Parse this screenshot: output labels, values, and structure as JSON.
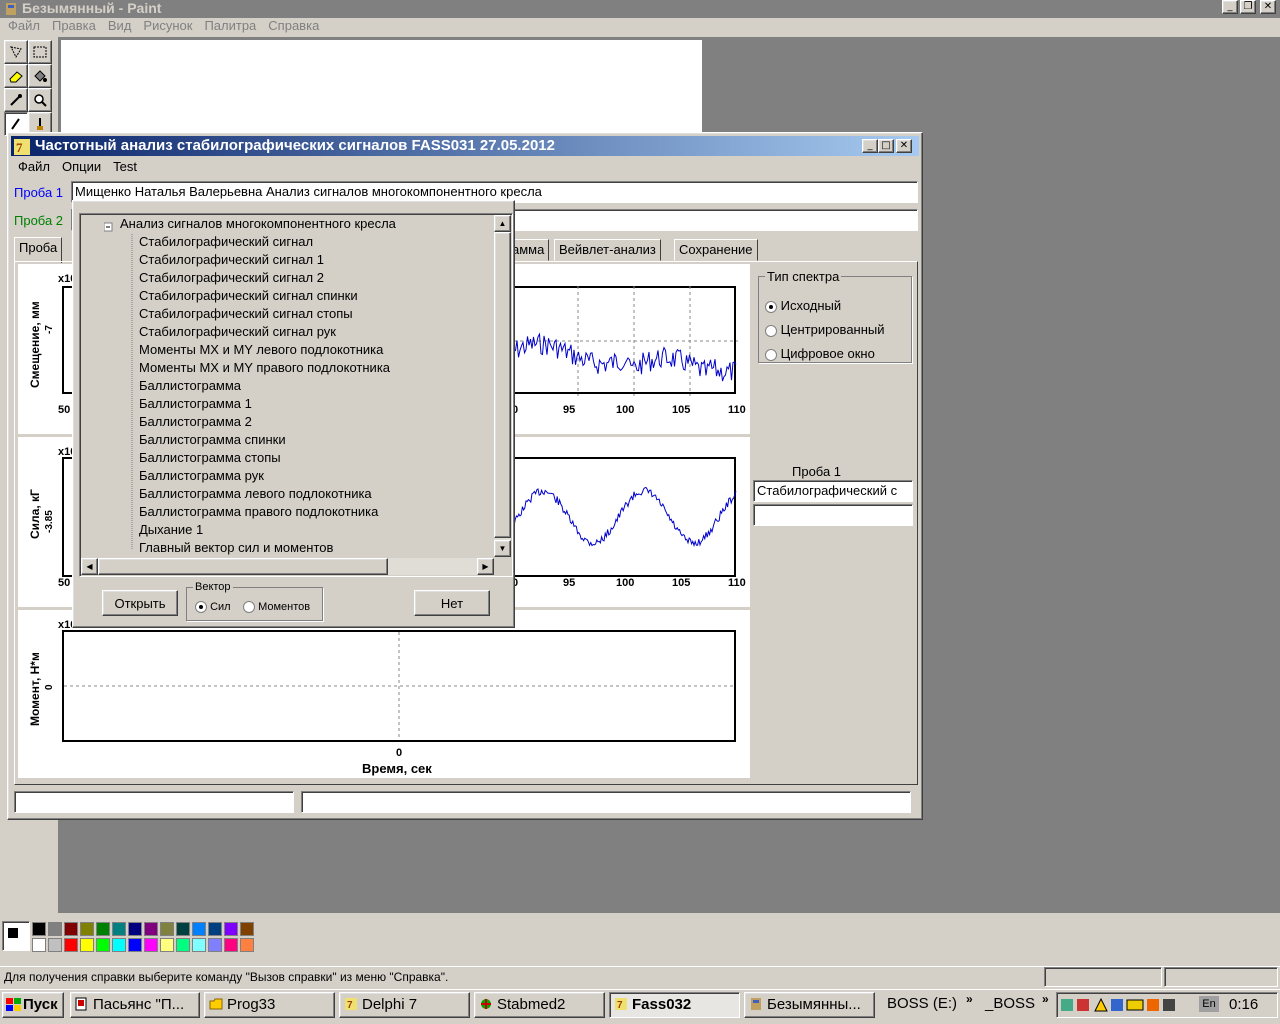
{
  "paint": {
    "title": "Безымянный - Paint",
    "menu": [
      "Файл",
      "Правка",
      "Вид",
      "Рисунок",
      "Палитра",
      "Справка"
    ],
    "status": "Для получения справки выберите команду \"Вызов справки\" из меню \"Справка\".",
    "palette": [
      "#000000",
      "#808080",
      "#800000",
      "#808000",
      "#008000",
      "#008080",
      "#000080",
      "#800080",
      "#808040",
      "#004040",
      "#0080ff",
      "#004080",
      "#8000ff",
      "#804000",
      "#ffffff",
      "#c0c0c0",
      "#ff0000",
      "#ffff00",
      "#00ff00",
      "#00ffff",
      "#0000ff",
      "#ff00ff",
      "#ffff80",
      "#00ff80",
      "#80ffff",
      "#8080ff",
      "#ff0080",
      "#ff8040"
    ]
  },
  "fass": {
    "title": "Частотный анализ стабилографических сигналов  FASS031  27.05.2012",
    "menu": [
      "Файл",
      "Опции",
      "Test"
    ],
    "probe1_label": "Проба 1",
    "probe1_value": "Мищенко Наталья Валерьевна Анализ сигналов многокомпонентного кресла",
    "probe2_label": "Проба 2",
    "tabs": [
      "Проба",
      "амма",
      "Вейвлет-анализ",
      "Сохранение"
    ],
    "spectrum": {
      "legend": "Тип спектра",
      "options": [
        "Исходный",
        "Центрированный",
        "Цифровое окно"
      ],
      "selected": 0
    },
    "probe_side_label": "Проба 1",
    "probe_side_value": "Стабилографический с",
    "charts": {
      "top": {
        "ylabel": "Смещение, мм",
        "ytick": "-7",
        "exp": "x10",
        "xticks_left": "50",
        "xticks_right": [
          "0",
          "95",
          "100",
          "105",
          "110"
        ]
      },
      "mid": {
        "ylabel": "Сила, кГ",
        "ytick": "-3.85",
        "exp": "x10",
        "xticks_left": "50",
        "xticks_right": [
          "0",
          "95",
          "100",
          "105",
          "110"
        ]
      },
      "bottom": {
        "ylabel": "Момент, Н*м",
        "ytick": "0",
        "exp": "x10",
        "xtick": "0",
        "xlabel": "Время, сек"
      }
    }
  },
  "dialog": {
    "root": "Анализ сигналов многокомпонентного кресла",
    "items": [
      "Стабилографический сигнал",
      "Стабилографический сигнал 1",
      "Стабилографический сигнал 2",
      "Стабилографический сигнал спинки",
      "Стабилографический сигнал стопы",
      "Стабилографический сигнал рук",
      "Моменты MX и MY левого подлокотника",
      "Моменты MX и MY правого подлокотника",
      "Баллистограмма",
      "Баллистограмма 1",
      "Баллистограмма 2",
      "Баллистограмма спинки",
      "Баллистограмма стопы",
      "Баллистограмма рук",
      "Баллистограмма левого подлокотника",
      "Баллистограмма правого подлокотника",
      "Дыхание 1",
      "Главный вектор сил и моментов"
    ],
    "open": "Открыть",
    "vector_legend": "Вектор",
    "vector_options": [
      "Сил",
      "Моментов"
    ],
    "no": "Нет"
  },
  "taskbar": {
    "start": "Пуск",
    "buttons": [
      "Пасьянс \"П...",
      "Prog33",
      "Delphi 7",
      "Stabmed2",
      "Fass032",
      "Безымянны..."
    ],
    "active": 4,
    "drive": "BOSS (E:)",
    "folder": "_BOSS",
    "lang": "En",
    "clock": "0:16"
  }
}
